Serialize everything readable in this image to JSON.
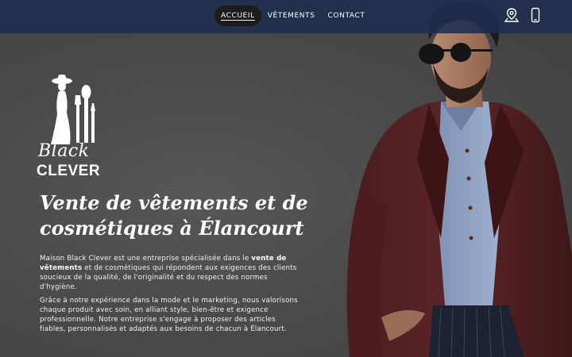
{
  "nav": {
    "items": [
      {
        "label": "ACCUEIL",
        "active": true
      },
      {
        "label": "VÊTEMENTS",
        "active": false
      },
      {
        "label": "CONTACT",
        "active": false
      }
    ],
    "icons": [
      "map-pin-icon",
      "phone-icon"
    ],
    "bar_color": "#1e2d50"
  },
  "logo": {
    "line1": "Black",
    "line2": "CLEVER"
  },
  "hero": {
    "headline": "Vente de vêtements et de cosmétiques à Élancourt",
    "p1_before": "Maison Black Clever est une entreprise spécialisée dans le ",
    "p1_bold": "vente de vêtements",
    "p1_after": " et de cosmétiques qui répondent aux exigences des clients soucieux de la qualité, de l'originalité et du respect des normes d'hygiène.",
    "p2": "Grâce à notre expérience dans la mode et le marketing, nous valorisons chaque produit avec soin, en alliant style, bien-être et exigence professionnelle. Notre entreprise s'engage à proposer des articles fiables, personnalisés et adaptés aux besoins de chacun à Élancourt."
  }
}
